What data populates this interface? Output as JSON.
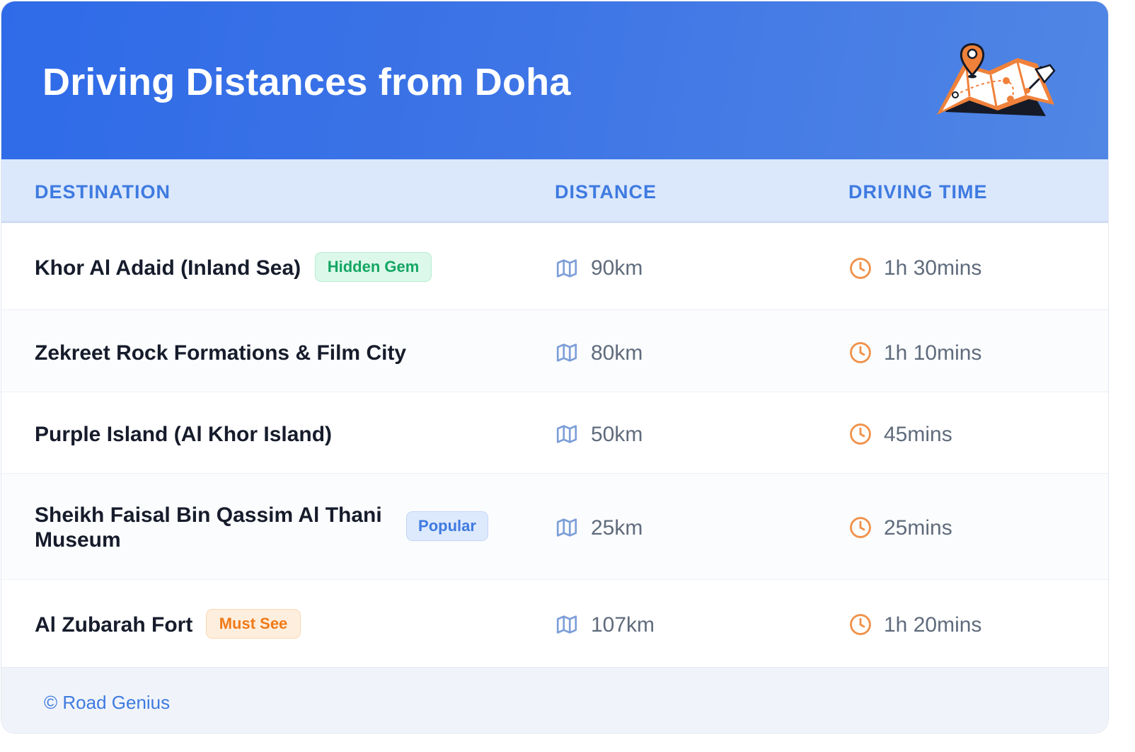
{
  "header": {
    "title": "Driving Distances from Doha",
    "illustration": "map-with-pins-illustration"
  },
  "table": {
    "columns": [
      "DESTINATION",
      "DISTANCE",
      "DRIVING TIME"
    ],
    "icons": {
      "distance": "map-icon",
      "time": "clock-icon"
    },
    "rows": [
      {
        "destination": "Khor Al Adaid (Inland Sea)",
        "badge": "Hidden Gem",
        "distance": "90km",
        "time": "1h 30mins"
      },
      {
        "destination": "Zekreet Rock Formations & Film City",
        "badge": "",
        "distance": "80km",
        "time": "1h 10mins"
      },
      {
        "destination": "Purple Island (Al Khor Island)",
        "badge": "",
        "distance": "50km",
        "time": "45mins"
      },
      {
        "destination": "Sheikh Faisal Bin Qassim Al Thani",
        "destination_line2": "Museum",
        "badge": "Popular",
        "distance": "25km",
        "time": "25mins"
      },
      {
        "destination": "Al Zubarah Fort",
        "badge": "Must See",
        "distance": "107km",
        "time": "1h 20mins"
      }
    ]
  },
  "footer": {
    "text": "© Road Genius"
  },
  "colors": {
    "header_gradient_start": "#2f6be8",
    "header_gradient_end": "#5086e4",
    "column_header_bg": "#dbe8fc",
    "column_header_text": "#3e7ae0",
    "map_icon": "#7d9fd8",
    "clock_icon": "#f0914a",
    "badge_green": "#14a663",
    "badge_blue": "#3e7ae0",
    "badge_orange": "#ef7a17"
  }
}
